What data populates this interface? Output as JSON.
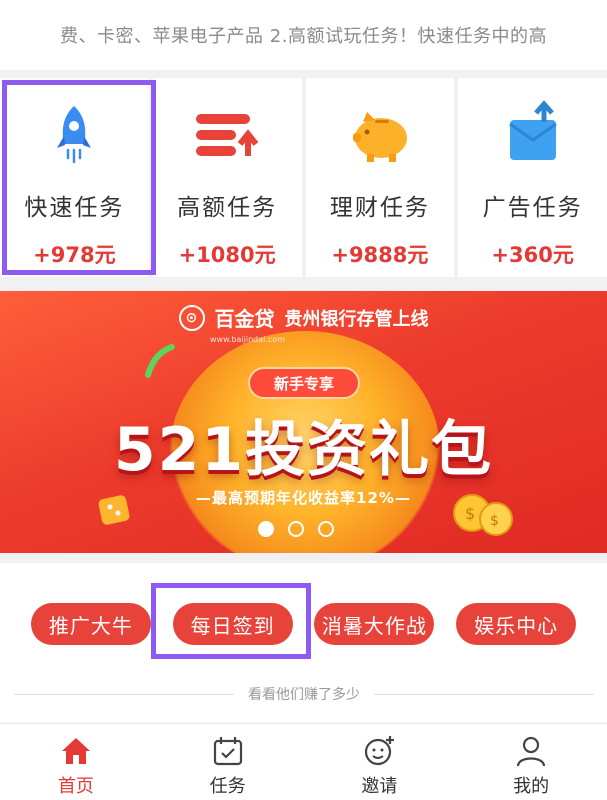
{
  "notice": {
    "text": "费、卡密、苹果电子产品  2.高额试玩任务！快速任务中的高"
  },
  "task_cards": [
    {
      "label": "快速任务",
      "reward": "+978元",
      "icon": "rocket-icon"
    },
    {
      "label": "高额任务",
      "reward": "+1080元",
      "icon": "stack-up-icon"
    },
    {
      "label": "理财任务",
      "reward": "+9888元",
      "icon": "piggy-bank-icon"
    },
    {
      "label": "广告任务",
      "reward": "+360元",
      "icon": "box-upload-icon"
    }
  ],
  "banner": {
    "brand": "百金贷",
    "brand_url": "www.baijindai.com",
    "partner": "贵州银行存管上线",
    "ribbon": "新手专享",
    "headline": "521投资礼包",
    "subline": "—最高预期年化收益率12%—",
    "slide_count": 3,
    "active_slide": 1
  },
  "shortcuts": [
    "推广大牛",
    "每日签到",
    "消暑大作战",
    "娱乐中心"
  ],
  "divider_text": "看看他们赚了多少",
  "tabbar": [
    {
      "label": "首页",
      "icon": "home-icon",
      "active": true
    },
    {
      "label": "任务",
      "icon": "calendar-check-icon",
      "active": false
    },
    {
      "label": "邀请",
      "icon": "smile-add-icon",
      "active": false
    },
    {
      "label": "我的",
      "icon": "user-icon",
      "active": false
    }
  ],
  "colors": {
    "accent": "#e53935",
    "highlight": "#8e5bf2",
    "pill": "#e8433b"
  }
}
